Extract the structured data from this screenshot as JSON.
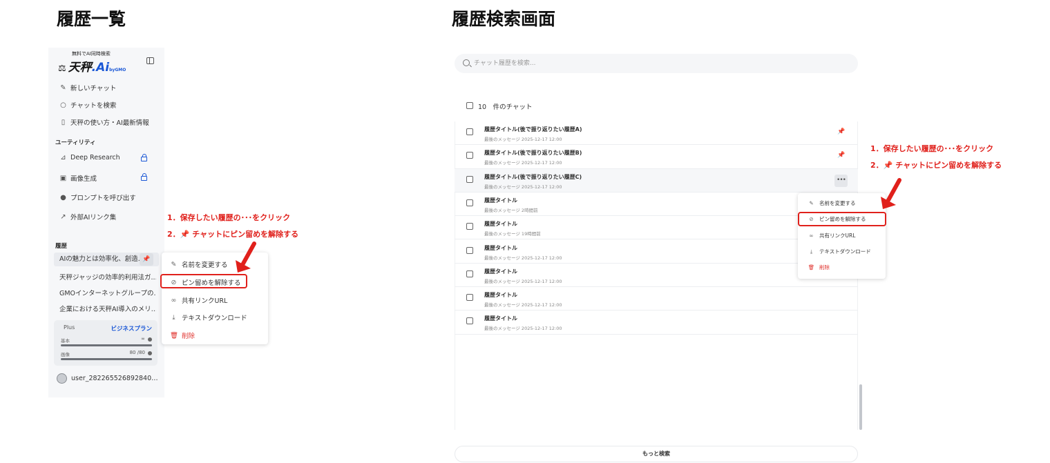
{
  "headings": {
    "left": "履歴一覧",
    "right": "履歴検索画面"
  },
  "sidebar": {
    "tagline": "無料でAI同時検索",
    "logo_text": "天秤",
    "logo_ai": "Ai",
    "logo_gmo": "byGMO",
    "nav": [
      {
        "label": "新しいチャット",
        "icon": "new-chat-icon"
      },
      {
        "label": "チャットを検索",
        "icon": "search-icon"
      },
      {
        "label": "天秤の使い方・AI最新情報",
        "icon": "book-icon"
      }
    ],
    "utility_heading": "ユーティリティ",
    "utilities": [
      {
        "label": "Deep Research",
        "icon": "research-icon",
        "locked": true
      },
      {
        "label": "画像生成",
        "icon": "image-icon",
        "locked": true
      },
      {
        "label": "プロンプトを呼び出す",
        "icon": "bulb-icon",
        "locked": false
      },
      {
        "label": "外部AIリンク集",
        "icon": "external-link-icon",
        "locked": false
      }
    ],
    "history_heading": "履歴",
    "history": [
      {
        "label": "AIの魅力とは効率化、創造..."
      },
      {
        "label": "天秤ジャッジの効率的利用法ガ..."
      },
      {
        "label": "GMOインターネットグループの..."
      },
      {
        "label": "企業における天秤AI導入のメリ..."
      }
    ],
    "plan": {
      "tag": "Plus",
      "name": "ビジネスプラン",
      "rows": [
        {
          "label": "基本",
          "value": "∞",
          "fill": 1.0
        },
        {
          "label": "画像",
          "value": "80 /80",
          "fill": 1.0
        }
      ]
    },
    "user": "user_282265526892840…"
  },
  "context_menu_items": [
    {
      "label": "名前を変更する",
      "icon": "pencil-icon"
    },
    {
      "label": "ピン留めを解除する",
      "icon": "unpin-icon"
    },
    {
      "label": "共有リンクURL",
      "icon": "link-icon"
    },
    {
      "label": "テキストダウンロード",
      "icon": "download-icon"
    },
    {
      "label": "削除",
      "icon": "trash-icon"
    }
  ],
  "instructions": {
    "step1": "1．保存したい履歴の･･･をクリック",
    "step2_prefix": "2．",
    "step2_text": "チャットにピン留めを解除する"
  },
  "search": {
    "placeholder": "チャット履歴を検索...",
    "count_label": "10　件のチャット",
    "rows": [
      {
        "title": "履歴タイトル(後で振り返りたい履歴A)",
        "sub": "最後のメッセージ 2025-12-17 12:00",
        "pinned": true
      },
      {
        "title": "履歴タイトル(後で振り返りたい履歴B)",
        "sub": "最後のメッセージ 2025-12-17 12:00",
        "pinned": true
      },
      {
        "title": "履歴タイトル(後で振り返りたい履歴C)",
        "sub": "最後のメッセージ 2025-12-17 12:00",
        "pinned": false,
        "menu": true
      },
      {
        "title": "履歴タイトル",
        "sub": "最後のメッセージ 2時間前"
      },
      {
        "title": "履歴タイトル",
        "sub": "最後のメッセージ 19時間前"
      },
      {
        "title": "履歴タイトル",
        "sub": "最後のメッセージ 2025-12-17 12:00"
      },
      {
        "title": "履歴タイトル",
        "sub": "最後のメッセージ 2025-12-17 12:00"
      },
      {
        "title": "履歴タイトル",
        "sub": "最後のメッセージ 2025-12-17 12:00"
      },
      {
        "title": "履歴タイトル",
        "sub": "最後のメッセージ 2025-12-17 12:00"
      }
    ],
    "more_button": "もっと検索"
  },
  "colors": {
    "accent": "#1a57d6",
    "alert": "#e0201b"
  }
}
